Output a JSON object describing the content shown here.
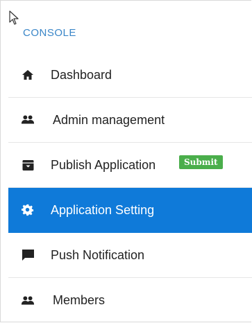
{
  "sidebar": {
    "section_title": "CONSOLE",
    "items": [
      {
        "label": "Dashboard",
        "icon": "home-icon"
      },
      {
        "label": "Admin management",
        "icon": "users-icon"
      },
      {
        "label": "Publish Application",
        "icon": "archive-box-icon",
        "badge": "Submit"
      },
      {
        "label": "Application Setting",
        "icon": "gear-icon",
        "active": true
      },
      {
        "label": "Push Notification",
        "icon": "chat-bubble-icon"
      },
      {
        "label": "Members",
        "icon": "users-icon"
      }
    ]
  },
  "colors": {
    "accent": "#0f7ad9",
    "section_title": "#3a86c8",
    "badge": "#4aae4b"
  }
}
